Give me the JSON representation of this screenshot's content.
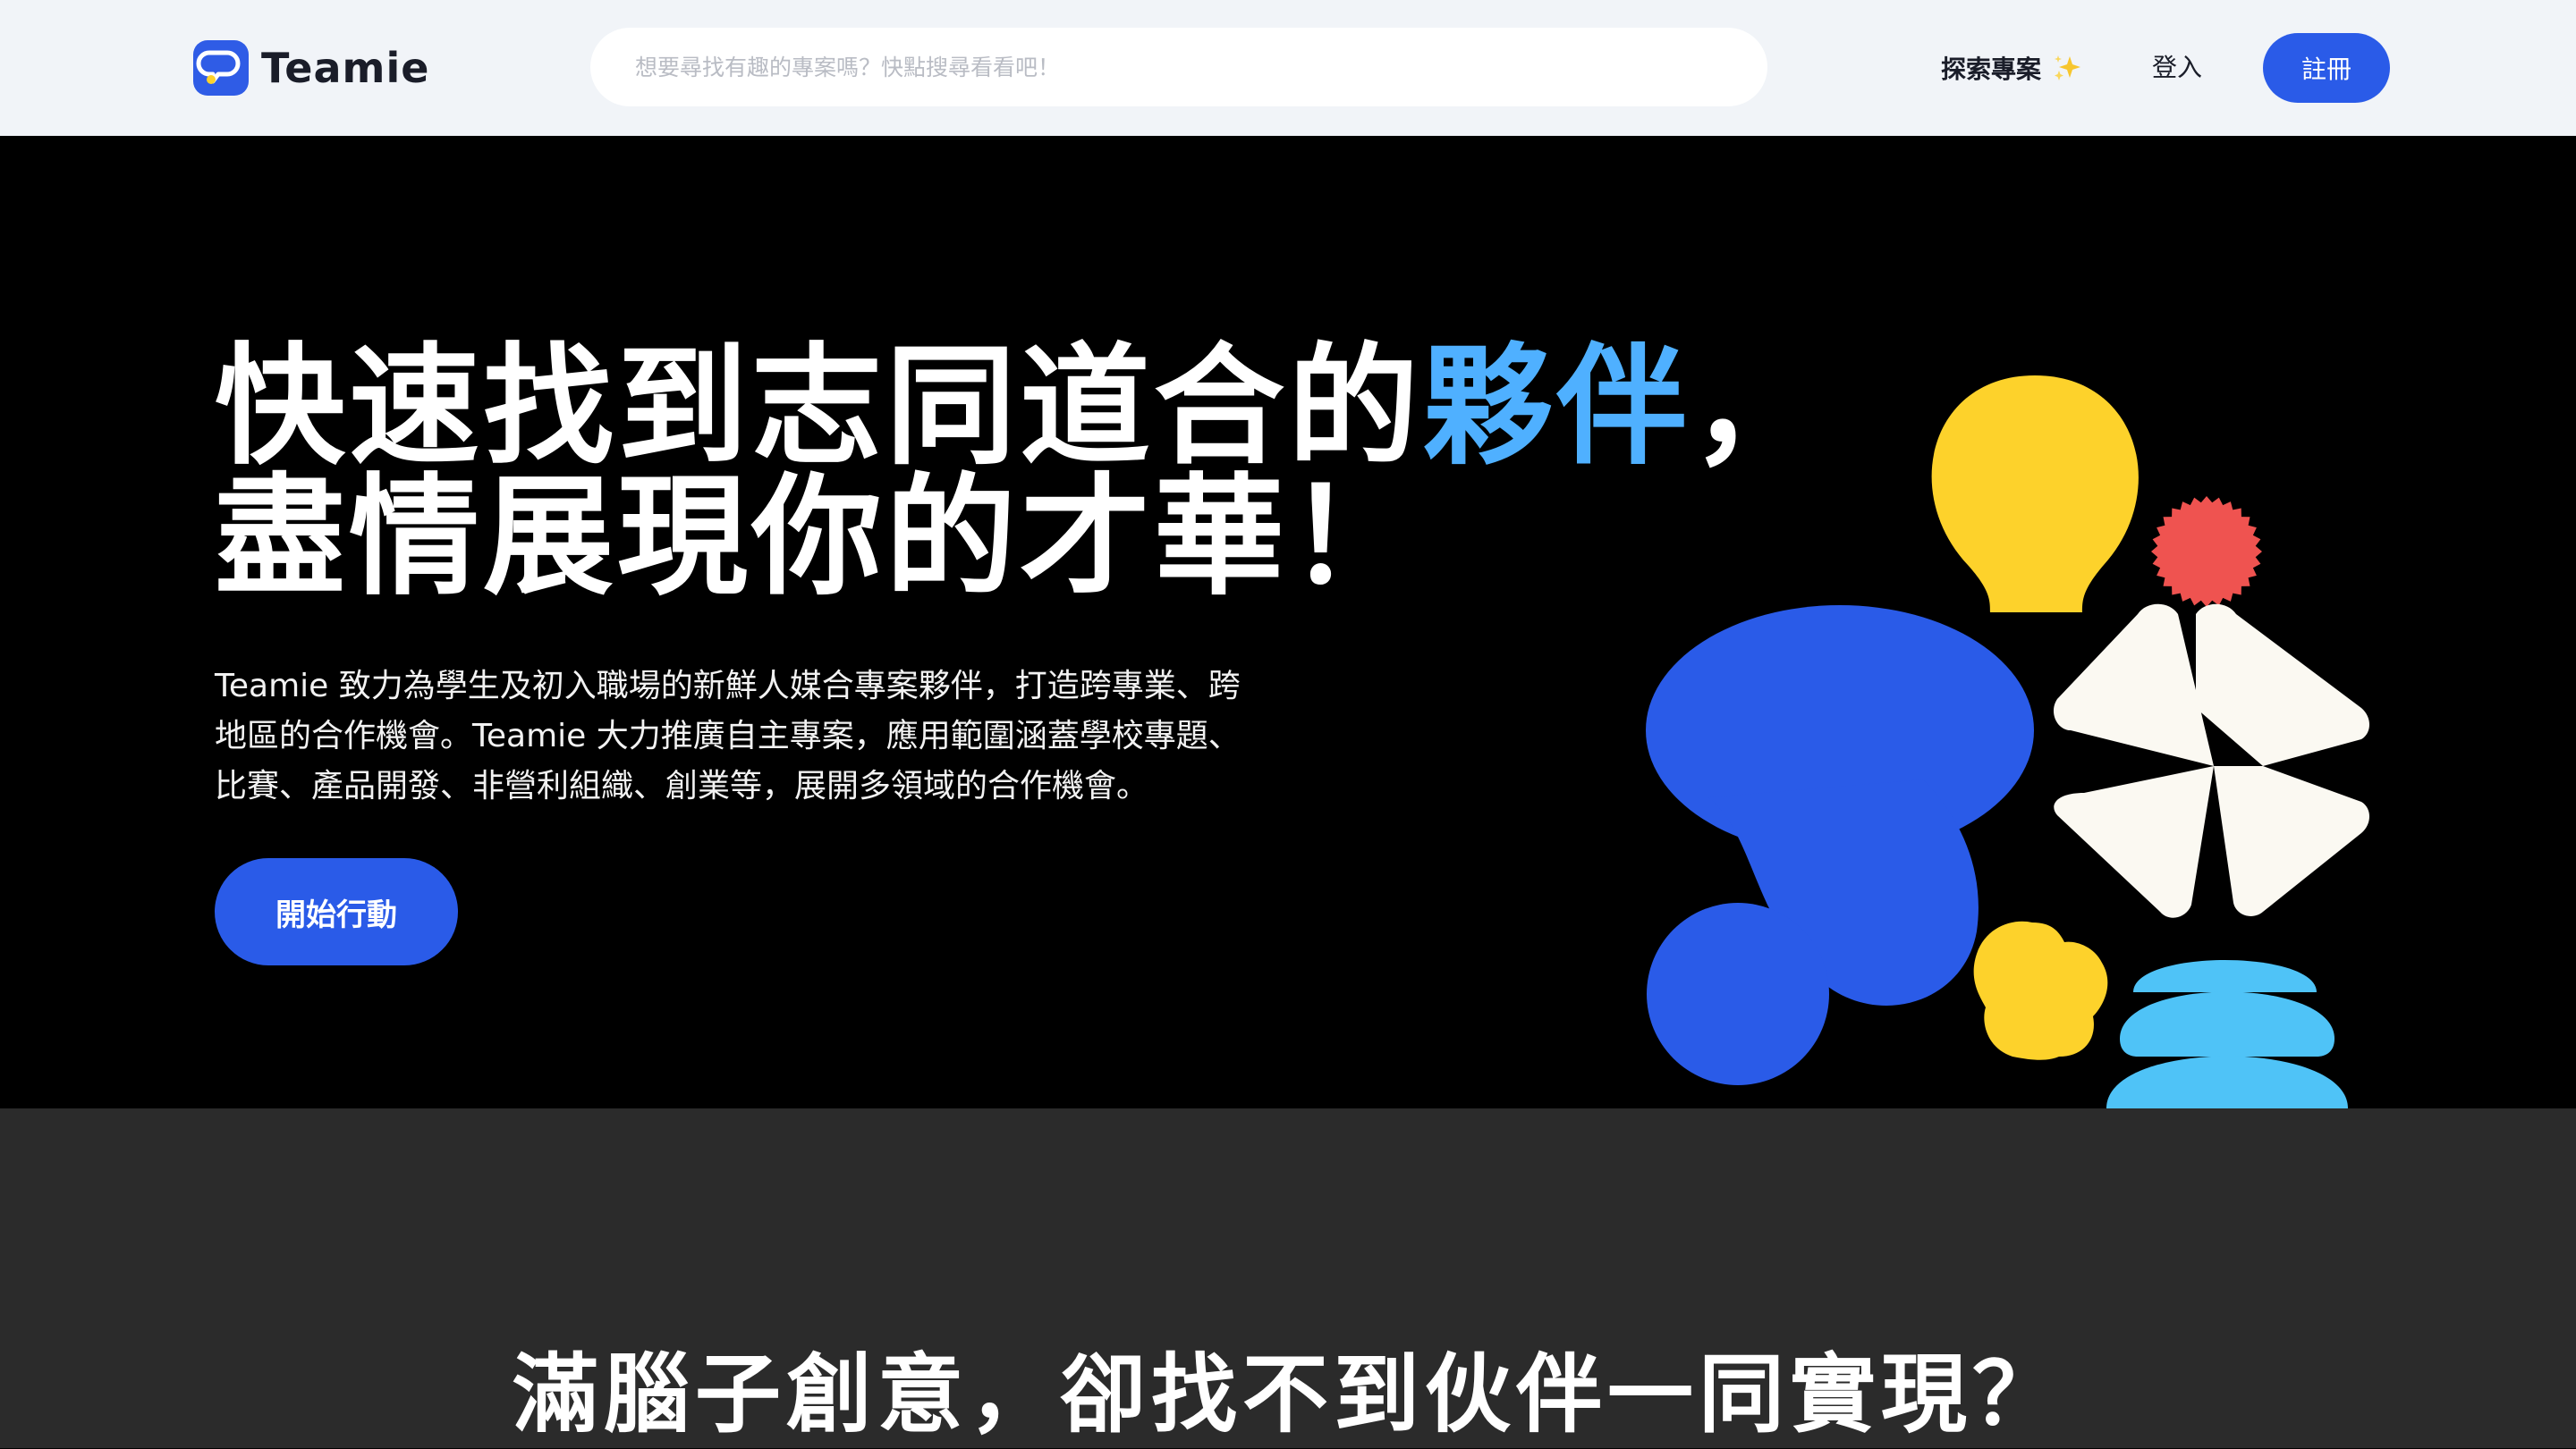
{
  "header": {
    "logo_text": "Teamie",
    "search_placeholder": "想要尋找有趣的專案嗎？快點搜尋看看吧！",
    "explore_label": "探索專案",
    "login_label": "登入",
    "register_label": "註冊"
  },
  "hero": {
    "title_part1": "快速找到志同道合的",
    "title_accent": "夥伴",
    "title_part2": "，",
    "title_line2": "盡情展現你的才華！",
    "description": "Teamie 致力為學生及初入職場的新鮮人媒合專案夥伴，打造跨專業、跨地區的合作機會。Teamie 大力推廣自主專案，應用範圍涵蓋學校專題、比賽、產品開發、非營利組織、創業等，展開多領域的合作機會。",
    "cta_label": "開始行動"
  },
  "section2": {
    "title": "滿腦子創意，卻找不到伙伴一同實現？"
  },
  "colors": {
    "primary_blue": "#2a5be8",
    "accent_light_blue": "#4fb0ff",
    "yellow": "#fdd22b",
    "red": "#ef5350",
    "cream": "#fbf9f2",
    "sky": "#4fc3f7",
    "header_bg": "#f1f4f8",
    "section2_bg": "#2b2b2b"
  },
  "icons": {
    "logo": "teamie-logo-icon",
    "sparkle": "sparkle-icon"
  }
}
